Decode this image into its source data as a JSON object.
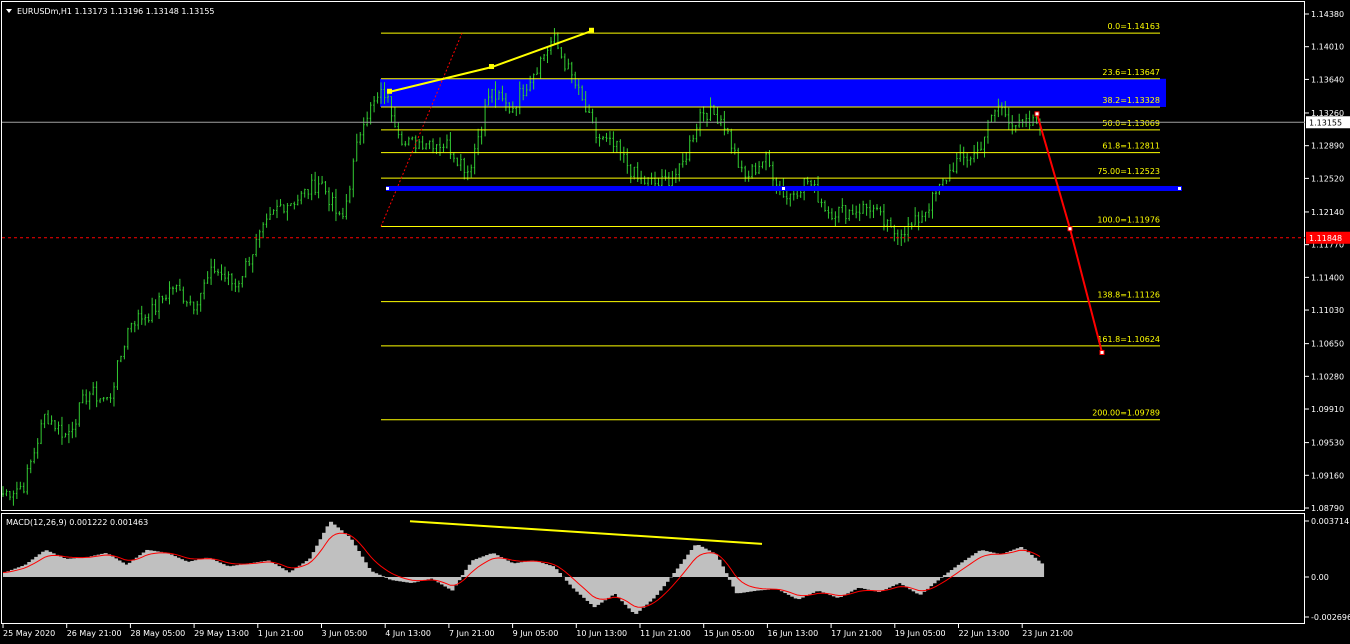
{
  "header": {
    "symbol_info": "EURUSDm,H1  1.13173 1.13196 1.13148 1.13155",
    "macd_info": "MACD(12,26,9) 0.001222 0.001463"
  },
  "colors": {
    "background": "#000000",
    "candles": "#33cc33",
    "fib": "#ffff00",
    "zone": "#0000ff",
    "projection": "#ff0000",
    "macd_hist": "#c0c0c0",
    "macd_signal": "#ff0000",
    "divergence": "#ffff00",
    "grid_border": "#ffffff"
  },
  "price_axis": {
    "ticks": [
      "1.14380",
      "1.14010",
      "1.13640",
      "1.13260",
      "1.12890",
      "1.12520",
      "1.12140",
      "1.11770",
      "1.11400",
      "1.11030",
      "1.10650",
      "1.10280",
      "1.09910",
      "1.09530",
      "1.09160",
      "1.08790"
    ],
    "current_price": "1.13155",
    "marker_price": "1.11848"
  },
  "macd_axis": {
    "ticks": [
      "0.003714",
      "0.00",
      "-0.002696"
    ]
  },
  "time_axis": {
    "labels": [
      "25 May 2020",
      "26 May 21:00",
      "28 May 05:00",
      "29 May 13:00",
      "1 Jun 21:00",
      "3 Jun 05:00",
      "4 Jun 13:00",
      "7 Jun 21:00",
      "9 Jun 05:00",
      "10 Jun 13:00",
      "11 Jun 21:00",
      "15 Jun 05:00",
      "16 Jun 13:00",
      "17 Jun 21:00",
      "19 Jun 05:00",
      "22 Jun 13:00",
      "23 Jun 21:00"
    ]
  },
  "fibonacci": {
    "levels": [
      {
        "label": "0.0=1.14163",
        "price": 1.14163
      },
      {
        "label": "23.6=1.13647",
        "price": 1.13647
      },
      {
        "label": "38.2=1.13328",
        "price": 1.13328
      },
      {
        "label": "50.0=1.13069",
        "price": 1.13069
      },
      {
        "label": "61.8=1.12811",
        "price": 1.12811
      },
      {
        "label": "75.00=1.12523",
        "price": 1.12523
      },
      {
        "label": "100.0=1.11976",
        "price": 1.11976
      },
      {
        "label": "138.8=1.11126",
        "price": 1.11126
      },
      {
        "label": "161.8=1.10624",
        "price": 1.10624
      },
      {
        "label": "200.00=1.09789",
        "price": 1.09789
      }
    ]
  },
  "chart_data": {
    "type": "line",
    "symbol": "EURUSDm",
    "timeframe": "H1",
    "ylim": [
      1.0879,
      1.1438
    ],
    "x_labels": [
      "25 May 2020",
      "26 May 21:00",
      "28 May 05:00",
      "29 May 13:00",
      "1 Jun 21:00",
      "3 Jun 05:00",
      "4 Jun 13:00",
      "7 Jun 21:00",
      "9 Jun 05:00",
      "10 Jun 13:00",
      "11 Jun 21:00",
      "15 Jun 05:00",
      "16 Jun 13:00",
      "17 Jun 21:00",
      "19 Jun 05:00",
      "22 Jun 13:00",
      "23 Jun 21:00"
    ],
    "price_anchors": [
      [
        "25 May 2020",
        1.0895
      ],
      [
        "25 May",
        1.0905
      ],
      [
        "26 May",
        1.0985
      ],
      [
        "26 May 21:00",
        1.096
      ],
      [
        "27 May",
        1.101
      ],
      [
        "28 May 05:00",
        1.1
      ],
      [
        "28 May",
        1.109
      ],
      [
        "29 May",
        1.11
      ],
      [
        "29 May 13:00",
        1.113
      ],
      [
        "30 May",
        1.111
      ],
      [
        "1 Jun",
        1.115
      ],
      [
        "1 Jun 21:00",
        1.113
      ],
      [
        "2 Jun",
        1.118
      ],
      [
        "2 Jun 21:00",
        1.122
      ],
      [
        "3 Jun 05:00",
        1.123
      ],
      [
        "3 Jun",
        1.125
      ],
      [
        "4 Jun",
        1.12
      ],
      [
        "4 Jun 13:00",
        1.132
      ],
      [
        "5 Jun",
        1.135
      ],
      [
        "5 Jun 21:00",
        1.129
      ],
      [
        "7 Jun 21:00",
        1.1295
      ],
      [
        "8 Jun",
        1.129
      ],
      [
        "8 Jun 21:00",
        1.126
      ],
      [
        "9 Jun 05:00",
        1.135
      ],
      [
        "9 Jun 21:00",
        1.133
      ],
      [
        "10 Jun",
        1.137
      ],
      [
        "10 Jun 13:00",
        1.141
      ],
      [
        "11 Jun",
        1.136
      ],
      [
        "11 Jun 12:00",
        1.13
      ],
      [
        "11 Jun 21:00",
        1.1285
      ],
      [
        "12 Jun",
        1.125
      ],
      [
        "12 Jun 21:00",
        1.1245
      ],
      [
        "15 Jun",
        1.126
      ],
      [
        "15 Jun 05:00",
        1.133
      ],
      [
        "15 Jun 21:00",
        1.132
      ],
      [
        "16 Jun",
        1.125
      ],
      [
        "16 Jun 13:00",
        1.1275
      ],
      [
        "17 Jun",
        1.123
      ],
      [
        "17 Jun 13:00",
        1.125
      ],
      [
        "17 Jun 21:00",
        1.1215
      ],
      [
        "18 Jun",
        1.1215
      ],
      [
        "18 Jun 21:00",
        1.122
      ],
      [
        "19 Jun",
        1.119
      ],
      [
        "19 Jun 05:00",
        1.1198
      ],
      [
        "19 Jun 21:00",
        1.123
      ],
      [
        "22 Jun",
        1.127
      ],
      [
        "22 Jun 13:00",
        1.128
      ],
      [
        "23 Jun",
        1.1335
      ],
      [
        "23 Jun 12:00",
        1.131
      ],
      [
        "23 Jun 21:00",
        1.1316
      ]
    ],
    "fib_range": {
      "from": 1.11976,
      "to": 1.14163
    },
    "zone_upper": {
      "from": 1.13647,
      "to": 1.13328
    },
    "support_line": 1.124,
    "projection": [
      1.1325,
      1.1195,
      1.1055
    ],
    "horizontal_lines": {
      "current": 1.13155,
      "marker": 1.11848
    },
    "macd": {
      "name": "MACD(12,26,9)",
      "ylim": [
        -0.002696,
        0.003714
      ],
      "histogram_anchors": [
        0.0003,
        0.0008,
        0.0018,
        0.0012,
        0.0013,
        0.0016,
        0.0008,
        0.0018,
        0.0016,
        0.001,
        0.0013,
        0.0007,
        0.0009,
        0.0011,
        0.0003,
        0.0012,
        0.0037,
        0.0026,
        0.0004,
        -0.0002,
        -0.0004,
        -0.0001,
        -0.0009,
        0.0011,
        0.0016,
        0.0009,
        0.0011,
        0.0007,
        -0.0008,
        -0.002,
        -0.0011,
        -0.0025,
        -0.0013,
        0.0004,
        0.0022,
        0.0015,
        -0.0011,
        -0.0009,
        -0.0008,
        -0.0015,
        -0.0009,
        -0.0014,
        -0.0007,
        -0.001,
        -0.0004,
        -0.0012,
        -0.0001,
        0.0009,
        0.0018,
        0.0015,
        0.002,
        0.0009
      ]
    }
  }
}
